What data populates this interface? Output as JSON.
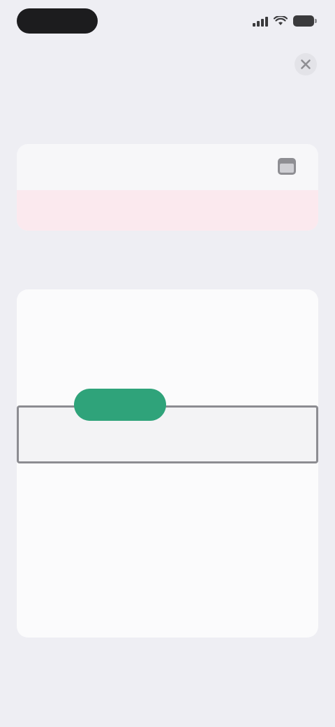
{
  "status_bar": {
    "time": "",
    "icons": [
      "signal-icon",
      "wifi-icon",
      "battery-icon"
    ]
  },
  "nav": {
    "close_icon": "close-icon"
  },
  "page": {
    "title": ""
  },
  "summary": {
    "label": "",
    "value": "",
    "icon": "calendar-icon",
    "alert_text": ""
  },
  "section": {
    "header": ""
  },
  "list": {
    "selected_index": 2,
    "rows": [
      {
        "name": "",
        "detail": "",
        "tag": "",
        "status": ""
      },
      {
        "name": "",
        "detail": "",
        "tag": "",
        "status": ""
      },
      {
        "name": "",
        "detail": "",
        "tag": "",
        "status": ""
      },
      {
        "name": "",
        "detail": "",
        "tag": "",
        "status": ""
      },
      {
        "name": "",
        "detail": "",
        "tag": "",
        "status": ""
      },
      {
        "name": "",
        "detail": "",
        "tag": "",
        "status": ""
      }
    ]
  },
  "floating_action": {
    "label": ""
  },
  "colors": {
    "background": "#eeeef3",
    "accent_pink": "#ef5b7f",
    "tag_amber": "#f3b347",
    "action_green": "#2fa37a",
    "selection_outline": "#8c8c91"
  }
}
